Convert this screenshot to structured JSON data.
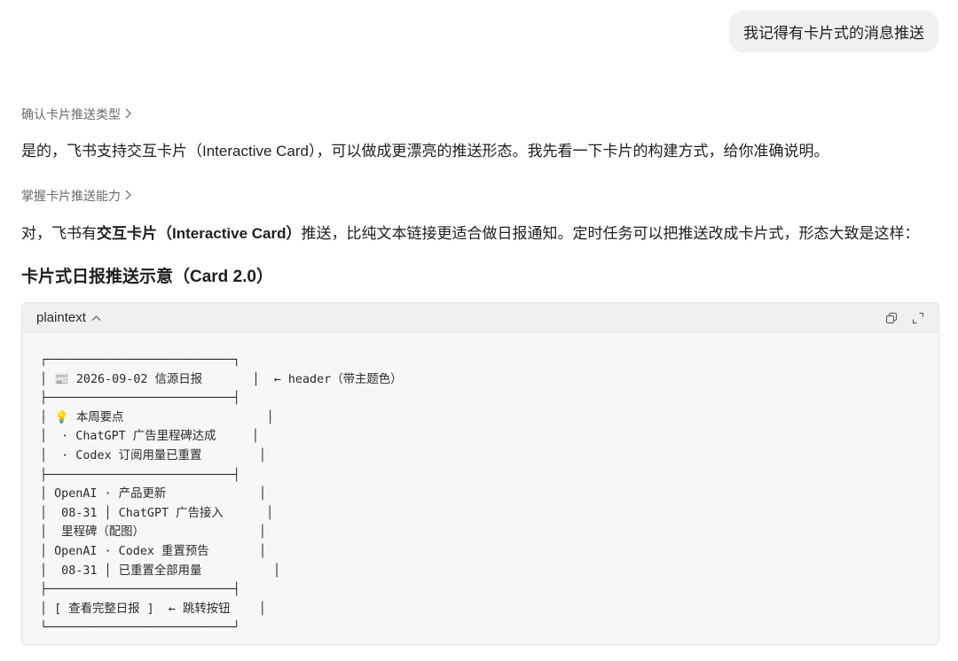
{
  "user_message": "我记得有卡片式的消息推送",
  "steps": [
    {
      "label": "确认卡片推送类型"
    },
    {
      "label": "掌握卡片推送能力"
    }
  ],
  "para1": "是的，飞书支持交互卡片（Interactive Card），可以做成更漂亮的推送形态。我先看一下卡片的构建方式，给你准确说明。",
  "para2": {
    "prefix": "对，飞书有",
    "bold": "交互卡片（Interactive Card）",
    "suffix": "推送，比纯文本链接更适合做日报通知。定时任务可以把推送改成卡片式，形态大致是这样："
  },
  "section_title": "卡片式日报推送示意（Card 2.0）",
  "code_block": {
    "language": "plaintext",
    "lines": [
      "┌──────────────────────────┐",
      "│ 📰 2026-09-02 信源日报       │  ← header（带主题色）",
      "├──────────────────────────┤",
      "│ 💡 本周要点                    │",
      "│  · ChatGPT 广告里程碑达成     │",
      "│  · Codex 订阅用量已重置        │",
      "├──────────────────────────┤",
      "│ OpenAI · 产品更新             │",
      "│  08-31 │ ChatGPT 广告接入      │",
      "│  里程碑（配图）                │",
      "│ OpenAI · Codex 重置预告       │",
      "│  08-31 │ 已重置全部用量          │",
      "├──────────────────────────┤",
      "│ [ 查看完整日报 ]  ← 跳转按钮    │",
      "└──────────────────────────┘"
    ]
  },
  "icons": [
    "chevron-right-icon",
    "chevron-up-icon",
    "copy-icon",
    "expand-icon"
  ]
}
